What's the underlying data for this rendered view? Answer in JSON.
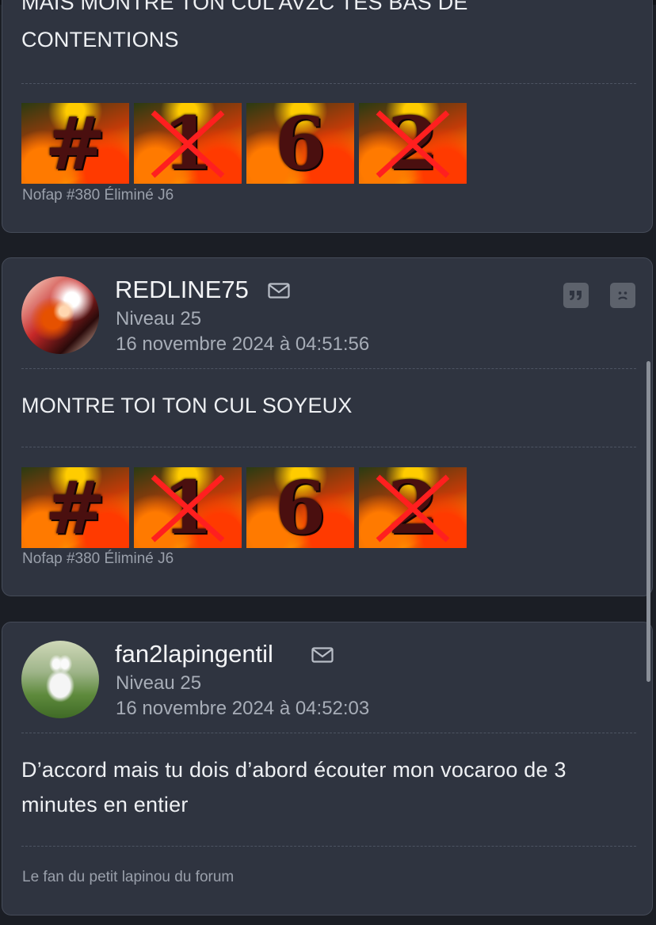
{
  "posts": [
    {
      "message": [
        "MAIS MONTRE TON CUL AVZC TES BAS DE",
        "CONTENTIONS"
      ],
      "signature": {
        "tiles": [
          {
            "glyph": "#",
            "crossed": false
          },
          {
            "glyph": "1",
            "crossed": true
          },
          {
            "glyph": "6",
            "crossed": false
          },
          {
            "glyph": "2",
            "crossed": true
          }
        ],
        "caption": "Nofap #380 Éliminé J6"
      }
    },
    {
      "author": "REDLINE75",
      "level": "Niveau 25",
      "date": "16 novembre 2024 à 04:51:56",
      "avatar_icon": "dragon-avatar",
      "actions": [
        "quote-icon",
        "sad-face-icon"
      ],
      "message": "MONTRE TOI TON CUL SOYEUX",
      "signature": {
        "tiles": [
          {
            "glyph": "#",
            "crossed": false
          },
          {
            "glyph": "1",
            "crossed": true
          },
          {
            "glyph": "6",
            "crossed": false
          },
          {
            "glyph": "2",
            "crossed": true
          }
        ],
        "caption": "Nofap #380 Éliminé J6"
      }
    },
    {
      "author": "fan2lapingentil",
      "level": "Niveau 25",
      "date": "16 novembre 2024 à 04:52:03",
      "avatar_icon": "rabbit-avatar",
      "message": [
        "D’accord mais tu dois d’abord écouter mon vocaroo de 3",
        "minutes en entier"
      ],
      "signature_text": "Le fan du petit lapinou du forum"
    }
  ],
  "colors": {
    "background": "#1b1e25",
    "card": "#2f3440",
    "card_border": "#454b58",
    "cross": "#ff1f1f"
  }
}
